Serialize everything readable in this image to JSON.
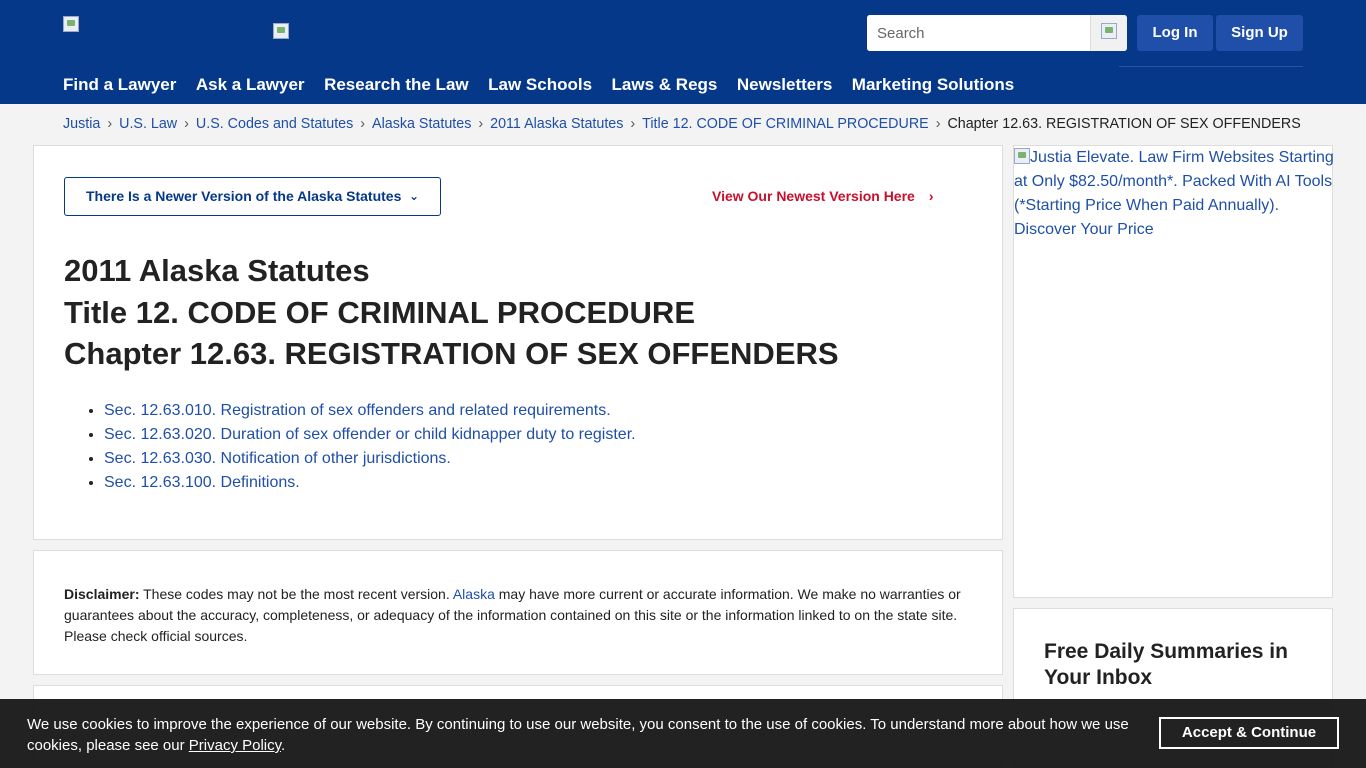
{
  "header": {
    "search_placeholder": "Search",
    "login_label": "Log In",
    "signup_label": "Sign Up",
    "nav": [
      "Find a Lawyer",
      "Ask a Lawyer",
      "Research the Law",
      "Law Schools",
      "Laws & Regs",
      "Newsletters",
      "Marketing Solutions"
    ]
  },
  "breadcrumb": {
    "items": [
      "Justia",
      "U.S. Law",
      "U.S. Codes and Statutes",
      "Alaska Statutes",
      "2011 Alaska Statutes",
      "Title 12. CODE OF CRIMINAL PROCEDURE"
    ],
    "separator": "›",
    "current": "Chapter 12.63. REGISTRATION OF SEX OFFENDERS"
  },
  "main": {
    "newer_version_label": "There Is a Newer Version of the Alaska Statutes",
    "newer_chevron": "⌄",
    "newest_link_label": "View Our Newest Version Here",
    "newest_arrow": "›",
    "title_lines": [
      "2011 Alaska Statutes",
      "Title 12. CODE OF CRIMINAL PROCEDURE",
      "Chapter 12.63. REGISTRATION OF SEX OFFENDERS"
    ],
    "sections": [
      "Sec. 12.63.010. Registration of sex offenders and related requirements.",
      "Sec. 12.63.020. Duration of sex offender or child kidnapper duty to register.",
      "Sec. 12.63.030. Notification of other jurisdictions.",
      "Sec. 12.63.100. Definitions."
    ]
  },
  "disclaimer": {
    "label": "Disclaimer:",
    "text_before": " These codes may not be the most recent version. ",
    "link": "Alaska",
    "text_after": " may have more current or accurate information. We make no warranties or guarantees about the accuracy, completeness, or adequacy of the information contained on this site or the information linked to on the state site. Please check official sources."
  },
  "sidebar": {
    "ad_alt": "Justia Elevate. Law Firm Websites Starting at Only $82.50/month*. Packed With AI Tools (*Starting Price When Paid Annually). Discover Your Price",
    "newsletter_title": "Free Daily Summaries in Your Inbox"
  },
  "cookie": {
    "text": "We use cookies to improve the experience of our website. By continuing to use our website, you consent to the use of cookies. To understand more about how we use cookies, please see our ",
    "link": "Privacy Policy",
    "after": ".",
    "button": "Accept & Continue"
  }
}
